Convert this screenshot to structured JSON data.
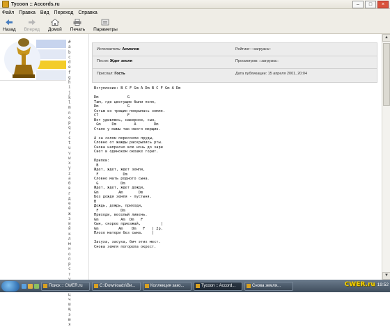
{
  "window": {
    "title": "Tycoon :: Accords.ru"
  },
  "menu": [
    "Файл",
    "Правка",
    "Вид",
    "Переход",
    "Справка"
  ],
  "toolbar": {
    "back": "Назад",
    "forward": "Вперед",
    "home": "Домой",
    "print": "Печать",
    "settings": "Параметры"
  },
  "alphabet": [
    "#",
    "a",
    "b",
    "c",
    "d",
    "e",
    "f",
    "g",
    "h",
    "i",
    "j",
    "k",
    "l",
    "m",
    "n",
    "o",
    "p",
    "q",
    "r",
    "s",
    "t",
    "u",
    "v",
    "w",
    "x",
    "y",
    "z",
    "а",
    "б",
    "в",
    "г",
    "д",
    "е",
    "ё",
    "ж",
    "з",
    "и",
    "й",
    "к",
    "л",
    "м",
    "н",
    "о",
    "п",
    "р",
    "с",
    "т",
    "у",
    "ф",
    "х",
    "ц",
    "ч",
    "ш",
    "щ",
    "э",
    "ю",
    "я"
  ],
  "song_info": {
    "performer_label": "Исполнитель:",
    "performer": "Асмолов",
    "song_label": "Песня:",
    "song": "Ждет земля",
    "sent_label": "Прислал:",
    "sent_by": "Гость",
    "rating_label": "Рейтинг:",
    "rating": "::загрузка::",
    "views_label": "Просмотров:",
    "views": "::загрузка::",
    "date_label": "Дата публикации:",
    "date": "15 апреля 2001, 20:04"
  },
  "chords_text": "Вступление: B C F Gm A Dm B C F Gm A Dm\n\nDm             G\nТам, где цветущие были поля,\nDm             G\nСетью из трещин покрылась земля.\nC7             F\nВот удивлюсь, наверное, сын,\n Gm     Dm        A        Dm\nСтало у мамы так много морщин.\n\nА за селом пересохли пруды,\nСловно от жажды раскрылись рты.\nСнова напрасно всю ночь до зари\nСвет в одиноком окошке горит.\n\nПрипев:\n B\nЖдет, ждет, ждет земля,\n F           Dm\nСловно мать родного сына.\n G          Dm\nЖдет, ждет, ждет дождя,\nGm         Am       Dm\nБез дождя земля - пустыня.\nB\nДождь, дождь, приходи,\n F          Dm\nПриходи, веселый ливень.\nGm          Am  Dm   F\nСын, скорее приезжай,         |\nGm         Am    Dm   F   | 2р.\nПлохо матери без сына.    |\n\nЗасуха, засуха, бич этих мест.\nСнова земля погорела окрест.",
  "taskbar": {
    "tasks": [
      "Поиск :: CWER.ru",
      "C:\\Downloads\\Ви...",
      "Коллекция зако...",
      "Tycoon :: Accord...",
      "Снова земля..."
    ],
    "watermark": "CWER.ru",
    "clock": "19:52"
  }
}
